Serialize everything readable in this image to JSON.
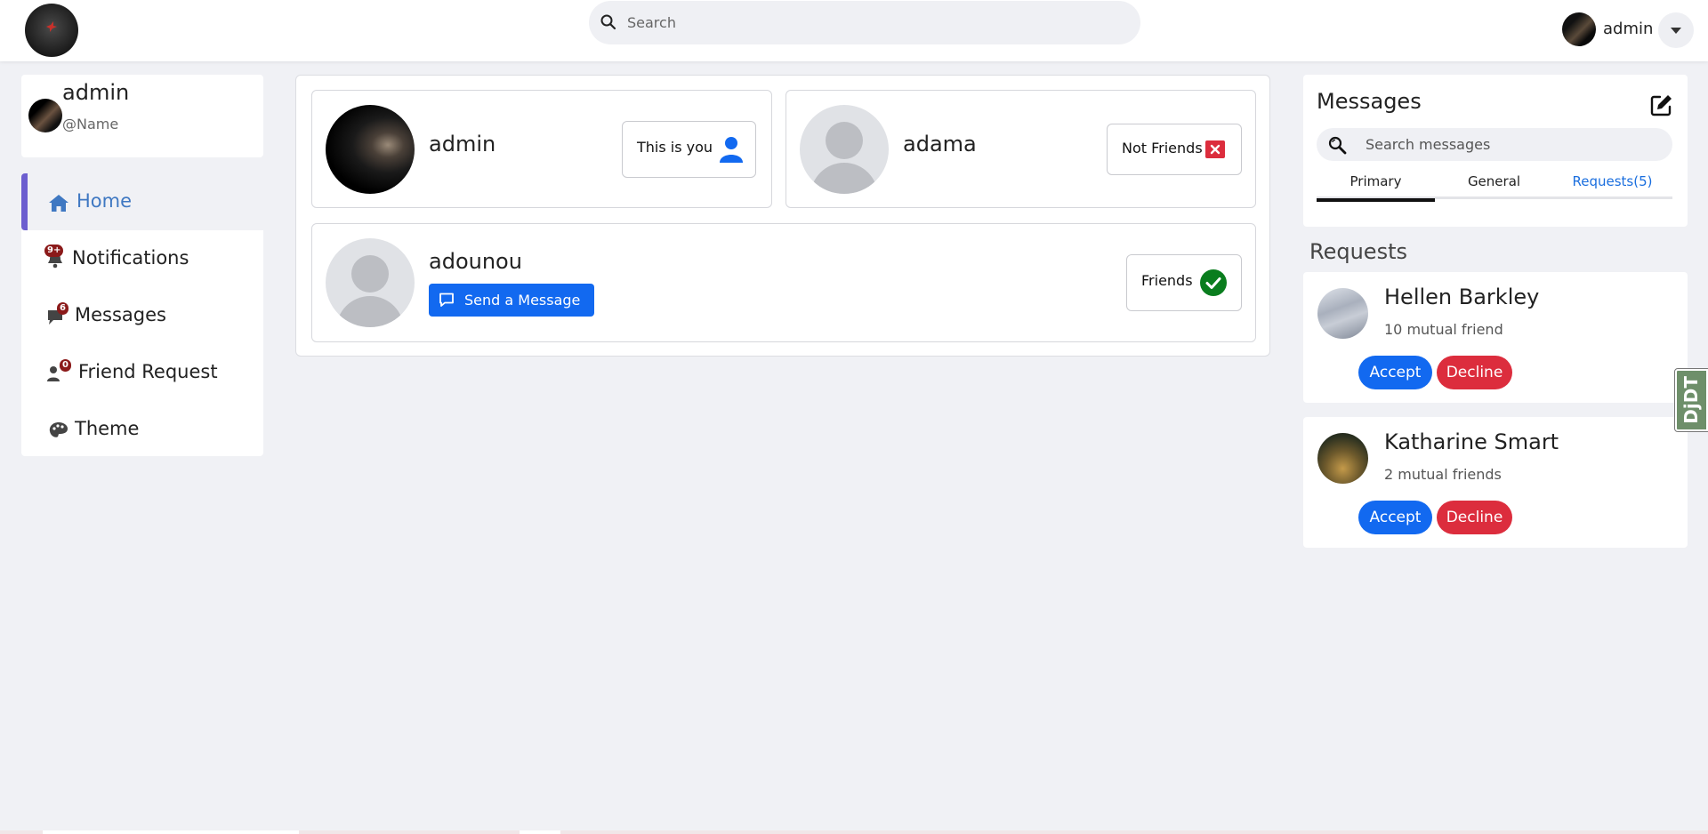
{
  "header": {
    "search_placeholder": "Search",
    "user_name": "admin"
  },
  "profile": {
    "name": "admin",
    "handle": "@Name"
  },
  "nav": {
    "items": [
      {
        "label": "Home",
        "icon": "home-icon",
        "active": true
      },
      {
        "label": "Notifications",
        "icon": "bell-icon",
        "badge": "9+"
      },
      {
        "label": "Messages",
        "icon": "chat-icon",
        "badge": "6"
      },
      {
        "label": "Friend Request",
        "icon": "users-icon",
        "badge": "0"
      },
      {
        "label": "Theme",
        "icon": "palette-icon"
      }
    ]
  },
  "users": [
    {
      "name": "admin",
      "status": "This is you",
      "status_icon": "user-icon"
    },
    {
      "name": "adama",
      "status": "Not Friends",
      "status_icon": "x-icon"
    },
    {
      "name": "adounou",
      "status": "Friends",
      "status_icon": "check-icon",
      "action": "Send a Message"
    }
  ],
  "messages": {
    "title": "Messages",
    "search_placeholder": "Search messages",
    "tabs": [
      "Primary",
      "General",
      "Requests(5)"
    ]
  },
  "requests": {
    "heading": "Requests",
    "items": [
      {
        "name": "Hellen Barkley",
        "mutual": "10 mutual friend",
        "accept": "Accept",
        "decline": "Decline"
      },
      {
        "name": "Katharine Smart",
        "mutual": "2 mutual friends",
        "accept": "Accept",
        "decline": "Decline"
      }
    ]
  },
  "debug_toolbar": {
    "label": "DjDT"
  },
  "colors": {
    "primary": "#1269f0",
    "danger": "#dc2d3d",
    "success": "#0a7d1e",
    "active_nav": "#3f78c2",
    "nav_indicator": "#6c5ecf",
    "badge": "#8b1a1a"
  }
}
